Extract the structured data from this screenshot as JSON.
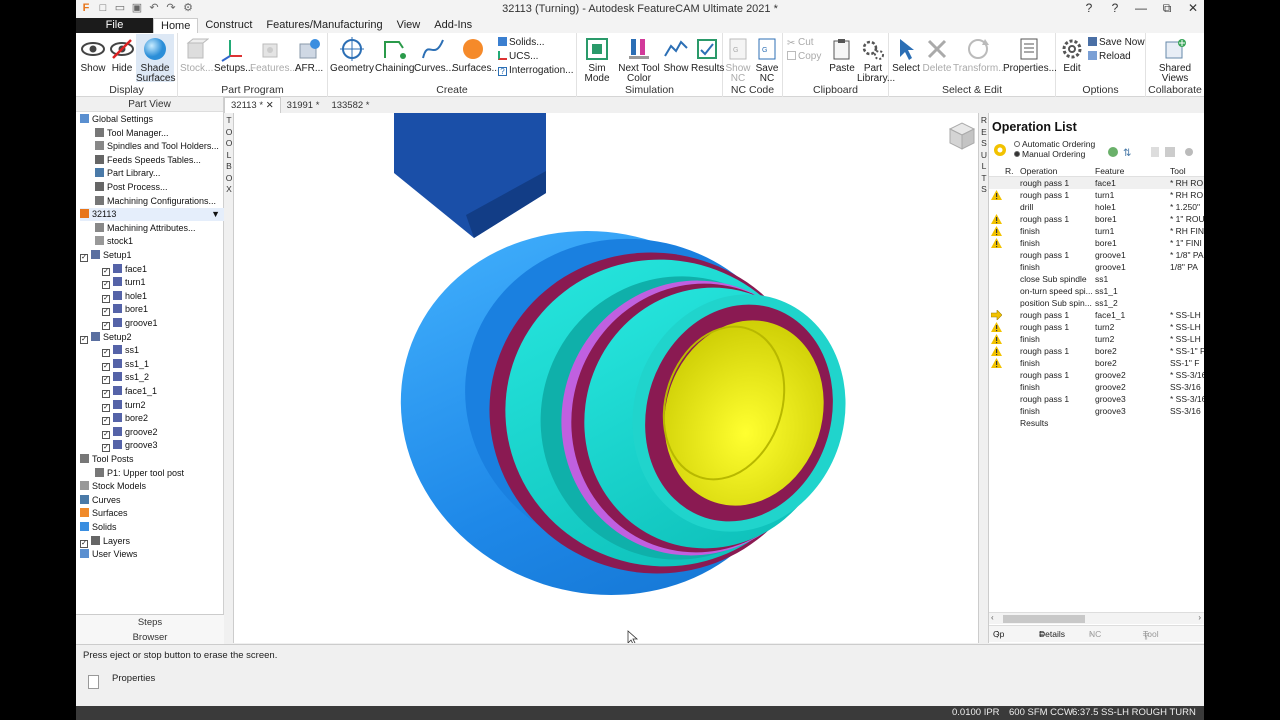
{
  "window": {
    "title": "32113 (Turning) - Autodesk FeatureCAM Ultimate 2021 *"
  },
  "ribbon_tabs": [
    {
      "label": "File"
    },
    {
      "label": "Home"
    },
    {
      "label": "Construct"
    },
    {
      "label": "Features/Manufacturing"
    },
    {
      "label": "View"
    },
    {
      "label": "Add-Ins"
    }
  ],
  "ribbon": {
    "display": {
      "label": "Display",
      "show": "Show",
      "hide": "Hide",
      "shade": "Shade",
      "surfaces": "Surfaces"
    },
    "part_program": {
      "label": "Part Program",
      "stock": "Stock...",
      "setups": "Setups...",
      "features": "Features...",
      "afr": "AFR..."
    },
    "create": {
      "label": "Create",
      "geometry": "Geometry",
      "chaining": "Chaining",
      "curves": "Curves...",
      "surfaces": "Surfaces...",
      "solids": "Solids...",
      "ucs": "UCS...",
      "interrogation": "Interrogation..."
    },
    "simulation": {
      "label": "Simulation",
      "sim": "Sim",
      "mode": "Mode",
      "next_tool": "Next Tool",
      "color": "Color",
      "show": "Show",
      "results": "Results"
    },
    "nc_code": {
      "label": "NC Code",
      "show": "Show",
      "nc": "NC",
      "save": "Save",
      "nc2": "NC"
    },
    "clipboard": {
      "label": "Clipboard",
      "cut": "Cut",
      "copy": "Copy",
      "paste": "Paste",
      "part": "Part",
      "library": "Library..."
    },
    "select_edit": {
      "label": "Select & Edit",
      "select": "Select",
      "delete": "Delete",
      "transform": "Transform...",
      "properties": "Properties..."
    },
    "options": {
      "label": "Options",
      "edit": "Edit",
      "save_now": "Save Now",
      "reload": "Reload"
    },
    "collaborate": {
      "label": "Collaborate",
      "shared": "Shared",
      "views": "Views"
    }
  },
  "part_view": {
    "title": "Part View",
    "tree": [
      {
        "label": "Global Settings",
        "indent": 0,
        "icon": "globe"
      },
      {
        "label": "Tool Manager...",
        "indent": 1,
        "icon": "tool"
      },
      {
        "label": "Spindles and Tool Holders...",
        "indent": 1,
        "icon": "spindle"
      },
      {
        "label": "Feeds  Speeds Tables...",
        "indent": 1,
        "icon": "table"
      },
      {
        "label": "Part Library...",
        "indent": 1,
        "icon": "library"
      },
      {
        "label": "Post Process...",
        "indent": 1,
        "icon": "post"
      },
      {
        "label": "Machining Configurations...",
        "indent": 1,
        "icon": "config"
      },
      {
        "label": "32113",
        "indent": 0,
        "icon": "part",
        "selected": true
      },
      {
        "label": "Machining Attributes...",
        "indent": 1,
        "icon": "attrib"
      },
      {
        "label": "stock1",
        "indent": 1,
        "icon": "stock"
      },
      {
        "label": "Setup1",
        "indent": 0,
        "icon": "setup",
        "check": true
      },
      {
        "label": "face1",
        "indent": 2,
        "icon": "feature",
        "check": true
      },
      {
        "label": "turn1",
        "indent": 2,
        "icon": "feature",
        "check": true
      },
      {
        "label": "hole1",
        "indent": 2,
        "icon": "feature",
        "check": true
      },
      {
        "label": "bore1",
        "indent": 2,
        "icon": "feature",
        "check": true
      },
      {
        "label": "groove1",
        "indent": 2,
        "icon": "feature",
        "check": true
      },
      {
        "label": "Setup2",
        "indent": 0,
        "icon": "setup",
        "check": true
      },
      {
        "label": "ss1",
        "indent": 2,
        "icon": "feature",
        "check": true
      },
      {
        "label": "ss1_1",
        "indent": 2,
        "icon": "feature",
        "check": true
      },
      {
        "label": "ss1_2",
        "indent": 2,
        "icon": "feature",
        "check": true
      },
      {
        "label": "face1_1",
        "indent": 2,
        "icon": "feature",
        "check": true
      },
      {
        "label": "turn2",
        "indent": 2,
        "icon": "feature",
        "check": true
      },
      {
        "label": "bore2",
        "indent": 2,
        "icon": "feature",
        "check": true
      },
      {
        "label": "groove2",
        "indent": 2,
        "icon": "feature",
        "check": true
      },
      {
        "label": "groove3",
        "indent": 2,
        "icon": "feature",
        "check": true
      },
      {
        "label": "Tool Posts",
        "indent": 0,
        "icon": "toolpost"
      },
      {
        "label": "P1: Upper tool post",
        "indent": 1,
        "icon": "toolpost"
      },
      {
        "label": "Stock Models",
        "indent": 0,
        "icon": "stock"
      },
      {
        "label": "Curves",
        "indent": 0,
        "icon": "curve"
      },
      {
        "label": "Surfaces",
        "indent": 0,
        "icon": "surface"
      },
      {
        "label": "Solids",
        "indent": 0,
        "icon": "solid"
      },
      {
        "label": "Layers",
        "indent": 0,
        "icon": "layers",
        "check": true
      },
      {
        "label": "User Views",
        "indent": 0,
        "icon": "views"
      }
    ],
    "footer": {
      "steps": "Steps",
      "browser": "Browser"
    }
  },
  "toolbox_label": "TOOLBOX",
  "results_label": "RESULTS",
  "doc_tabs": [
    {
      "label": "32113 *"
    },
    {
      "label": "31991 *"
    },
    {
      "label": "133582 *"
    }
  ],
  "op_list": {
    "title": "Operation List",
    "automatic": "Automatic Ordering",
    "manual": "Manual Ordering",
    "columns": {
      "r": "R.",
      "operation": "Operation",
      "feature": "Feature",
      "tool": "Tool"
    },
    "rows": [
      {
        "op": "rough pass 1",
        "feature": "face1",
        "tool": "* RH RO",
        "flag": ""
      },
      {
        "op": "rough pass 1",
        "feature": "turn1",
        "tool": "* RH RO",
        "flag": "warn"
      },
      {
        "op": "drill",
        "feature": "hole1",
        "tool": "* 1.250\"",
        "flag": ""
      },
      {
        "op": "rough pass 1",
        "feature": "bore1",
        "tool": "* 1\" ROU",
        "flag": "warn"
      },
      {
        "op": "finish",
        "feature": "turn1",
        "tool": "* RH FIN",
        "flag": "warn"
      },
      {
        "op": "finish",
        "feature": "bore1",
        "tool": "* 1\" FINI",
        "flag": "warn"
      },
      {
        "op": "rough pass 1",
        "feature": "groove1",
        "tool": "* 1/8\" PA",
        "flag": ""
      },
      {
        "op": "finish",
        "feature": "groove1",
        "tool": "1/8\" PA",
        "flag": ""
      },
      {
        "op": "close Sub spindle",
        "feature": "ss1",
        "tool": "",
        "flag": ""
      },
      {
        "op": "on-turn speed spi...",
        "feature": "ss1_1",
        "tool": "",
        "flag": ""
      },
      {
        "op": "position Sub spin...",
        "feature": "ss1_2",
        "tool": "",
        "flag": ""
      },
      {
        "op": "rough pass 1",
        "feature": "face1_1",
        "tool": "* SS-LH",
        "flag": "arrow"
      },
      {
        "op": "rough pass 1",
        "feature": "turn2",
        "tool": "* SS-LH",
        "flag": "warn"
      },
      {
        "op": "finish",
        "feature": "turn2",
        "tool": "* SS-LH",
        "flag": "warn"
      },
      {
        "op": "rough pass 1",
        "feature": "bore2",
        "tool": "* SS-1\" F",
        "flag": "warn"
      },
      {
        "op": "finish",
        "feature": "bore2",
        "tool": "SS-1\" F",
        "flag": "warn"
      },
      {
        "op": "rough pass 1",
        "feature": "groove2",
        "tool": "* SS-3/16",
        "flag": ""
      },
      {
        "op": "finish",
        "feature": "groove2",
        "tool": "SS-3/16",
        "flag": ""
      },
      {
        "op": "rough pass 1",
        "feature": "groove3",
        "tool": "* SS-3/16",
        "flag": ""
      },
      {
        "op": "finish",
        "feature": "groove3",
        "tool": "SS-3/16",
        "flag": ""
      },
      {
        "op": "Results",
        "feature": "",
        "tool": "",
        "flag": ""
      }
    ],
    "bottom_tabs": {
      "oplist": "Op List",
      "details": "Details",
      "nccode": "NC Code",
      "toolposts": "Tool Posts"
    }
  },
  "message": "Press eject or stop button to erase the screen.",
  "properties_label": "Properties",
  "statusbar": {
    "feed": "0.0100 IPR",
    "speed": "600 SFM  CCW",
    "time": "6:37.5",
    "tool": "SS-LH ROUGH TURN"
  },
  "colors": {
    "part_blue": "#1e88e8",
    "part_cyan": "#10d8d0",
    "part_maroon": "#8a1a52",
    "part_magenta": "#c060e0",
    "bore_yellow": "#f0f000",
    "holder_navy": "#1a4fa8",
    "warning": "#f2c200"
  }
}
